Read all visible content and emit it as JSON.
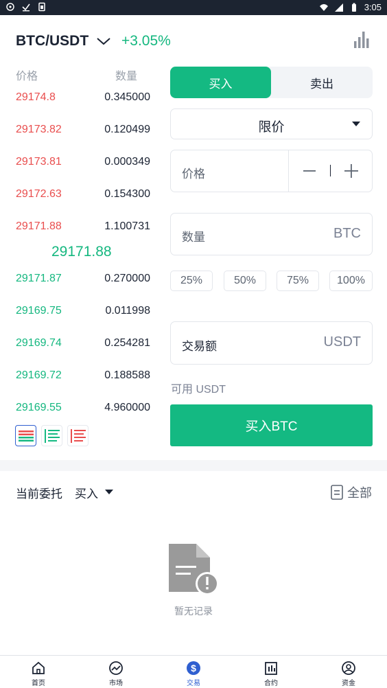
{
  "status_bar": {
    "time": "3:05"
  },
  "header": {
    "pair": "BTC/USDT",
    "change": "+3.05%"
  },
  "order_book": {
    "price_header": "价格",
    "qty_header": "数量",
    "asks": [
      {
        "price": "29174.8",
        "qty": "0.345000"
      },
      {
        "price": "29173.82",
        "qty": "0.120499"
      },
      {
        "price": "29173.81",
        "qty": "0.000349"
      },
      {
        "price": "29172.63",
        "qty": "0.154300"
      },
      {
        "price": "29171.88",
        "qty": "1.100731"
      }
    ],
    "last_price": "29171.88",
    "bids": [
      {
        "price": "29171.87",
        "qty": "0.270000"
      },
      {
        "price": "29169.75",
        "qty": "0.011998"
      },
      {
        "price": "29169.74",
        "qty": "0.254281"
      },
      {
        "price": "29169.72",
        "qty": "0.188588"
      },
      {
        "price": "29169.55",
        "qty": "4.960000"
      }
    ]
  },
  "trade": {
    "buy_tab": "买入",
    "sell_tab": "卖出",
    "order_type": "限价",
    "price_label": "价格",
    "qty_label": "数量",
    "qty_unit": "BTC",
    "percents": [
      "25%",
      "50%",
      "75%",
      "100%"
    ],
    "amount_label": "交易额",
    "amount_unit": "USDT",
    "available": "可用 USDT",
    "buy_button": "买入BTC"
  },
  "orders": {
    "title": "当前委托",
    "filter": "买入",
    "all": "全部",
    "empty": "暂无记录"
  },
  "nav": {
    "items": [
      {
        "label": "首页",
        "icon": "home-icon"
      },
      {
        "label": "市场",
        "icon": "market-icon"
      },
      {
        "label": "交易",
        "icon": "trade-icon"
      },
      {
        "label": "合约",
        "icon": "contract-icon"
      },
      {
        "label": "资金",
        "icon": "assets-icon"
      }
    ],
    "active_index": 2
  },
  "colors": {
    "green": "#14b982",
    "red": "#e94d4d",
    "nav_active": "#2f5fd0"
  }
}
